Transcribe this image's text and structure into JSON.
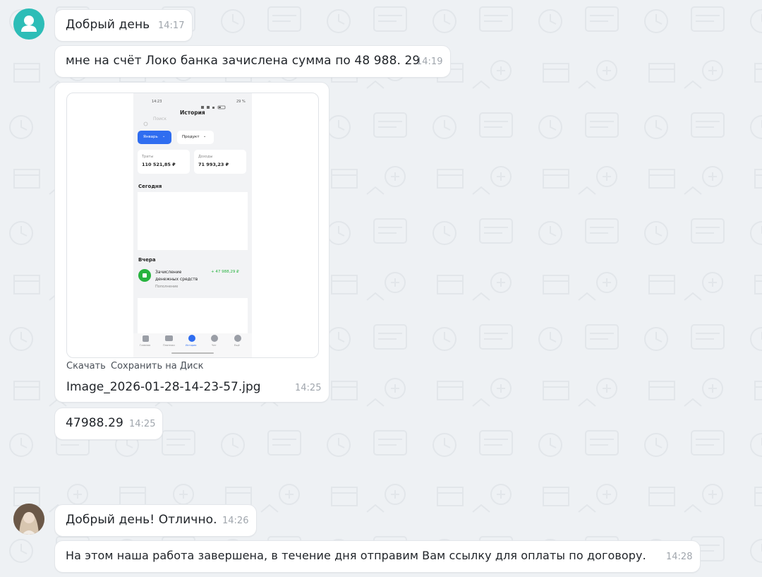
{
  "messages": [
    {
      "text": "Добрый день",
      "time": "14:17"
    },
    {
      "text": "мне на счёт Локо банка зачислена сумма по 48 988. 29",
      "time": "14:19"
    },
    {
      "text": "47988.29",
      "time": "14:25"
    },
    {
      "text": "Добрый день! Отлично.",
      "time": "14:26"
    },
    {
      "text": "На этом наша работа завершена, в течение дня отправим Вам ссылку для оплаты по договору.",
      "time": "14:28"
    }
  ],
  "attachment": {
    "download_label": "Скачать",
    "save_label": "Сохранить на Диск",
    "file_name": "Image_2026-01-28-14-23-57.jpg",
    "time": "14:25"
  },
  "phone_screenshot": {
    "status_time": "14:23",
    "status_battery": "29 %",
    "title": "История",
    "search_placeholder": "Поиск",
    "filter_month": "Январь",
    "filter_product": "Продукт",
    "spend_label": "Траты",
    "spend_value": "110 521,85 ₽",
    "income_label": "Доходы",
    "income_value": "71 993,23 ₽",
    "today_label": "Сегодня",
    "yesterday_label": "Вчера",
    "tx_title_line1": "Зачисление",
    "tx_title_line2": "денежных средств",
    "tx_subtitle": "Пополнение",
    "tx_amount": "+ 47 988,29 ₽",
    "nav": [
      "Главная",
      "Платежи",
      "История",
      "Чат",
      "Ещё"
    ]
  },
  "colors": {
    "background": "#eef1f4",
    "bubble": "#ffffff",
    "client_avatar": "#2dbdb7",
    "phone_accent": "#2f6df0",
    "phone_income": "#27b33f"
  }
}
